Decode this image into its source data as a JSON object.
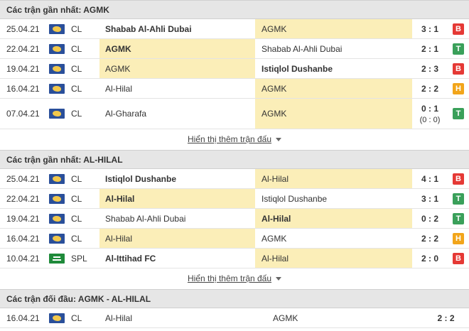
{
  "section1": {
    "title": "Các trận gần nhất: AGMK",
    "more_label": "Hiển thị thêm trận đấu",
    "rows": [
      {
        "date": "25.04.21",
        "comp": "CL",
        "flag": "world",
        "home": "Shabab Al-Ahli Dubai",
        "away": "AGMK",
        "score": "3 : 1",
        "sub": "",
        "result": "B",
        "result_color": "#e53935",
        "home_bold": true,
        "away_bold": false,
        "hl": "away"
      },
      {
        "date": "22.04.21",
        "comp": "CL",
        "flag": "world",
        "home": "AGMK",
        "away": "Shabab Al-Ahli Dubai",
        "score": "2 : 1",
        "sub": "",
        "result": "T",
        "result_color": "#3aa05a",
        "home_bold": true,
        "away_bold": false,
        "hl": "home"
      },
      {
        "date": "19.04.21",
        "comp": "CL",
        "flag": "world",
        "home": "AGMK",
        "away": "Istiqlol Dushanbe",
        "score": "2 : 3",
        "sub": "",
        "result": "B",
        "result_color": "#e53935",
        "home_bold": false,
        "away_bold": true,
        "hl": "home"
      },
      {
        "date": "16.04.21",
        "comp": "CL",
        "flag": "world",
        "home": "Al-Hilal",
        "away": "AGMK",
        "score": "2 : 2",
        "sub": "",
        "result": "H",
        "result_color": "#f2a51a",
        "home_bold": false,
        "away_bold": false,
        "hl": "away"
      },
      {
        "date": "07.04.21",
        "comp": "CL",
        "flag": "world",
        "home": "Al-Gharafa",
        "away": "AGMK",
        "score": "0 : 1",
        "sub": "(0 : 0)",
        "result": "T",
        "result_color": "#3aa05a",
        "home_bold": false,
        "away_bold": false,
        "hl": "away"
      }
    ]
  },
  "section2": {
    "title": "Các trận gần nhất: AL-HILAL",
    "more_label": "Hiển thị thêm trận đấu",
    "rows": [
      {
        "date": "25.04.21",
        "comp": "CL",
        "flag": "world",
        "home": "Istiqlol Dushanbe",
        "away": "Al-Hilal",
        "score": "4 : 1",
        "sub": "",
        "result": "B",
        "result_color": "#e53935",
        "home_bold": true,
        "away_bold": false,
        "hl": "away"
      },
      {
        "date": "22.04.21",
        "comp": "CL",
        "flag": "world",
        "home": "Al-Hilal",
        "away": "Istiqlol Dushanbe",
        "score": "3 : 1",
        "sub": "",
        "result": "T",
        "result_color": "#3aa05a",
        "home_bold": true,
        "away_bold": false,
        "hl": "home"
      },
      {
        "date": "19.04.21",
        "comp": "CL",
        "flag": "world",
        "home": "Shabab Al-Ahli Dubai",
        "away": "Al-Hilal",
        "score": "0 : 2",
        "sub": "",
        "result": "T",
        "result_color": "#3aa05a",
        "home_bold": false,
        "away_bold": true,
        "hl": "away"
      },
      {
        "date": "16.04.21",
        "comp": "CL",
        "flag": "world",
        "home": "Al-Hilal",
        "away": "AGMK",
        "score": "2 : 2",
        "sub": "",
        "result": "H",
        "result_color": "#f2a51a",
        "home_bold": false,
        "away_bold": false,
        "hl": "home"
      },
      {
        "date": "10.04.21",
        "comp": "SPL",
        "flag": "saudi",
        "home": "Al-Ittihad FC",
        "away": "Al-Hilal",
        "score": "2 : 0",
        "sub": "",
        "result": "B",
        "result_color": "#e53935",
        "home_bold": true,
        "away_bold": false,
        "hl": "away"
      }
    ]
  },
  "section3": {
    "title": "Các trận đối đầu: AGMK - AL-HILAL",
    "rows": [
      {
        "date": "16.04.21",
        "comp": "CL",
        "flag": "world",
        "home": "Al-Hilal",
        "away": "AGMK",
        "score": "2 : 2"
      }
    ]
  }
}
